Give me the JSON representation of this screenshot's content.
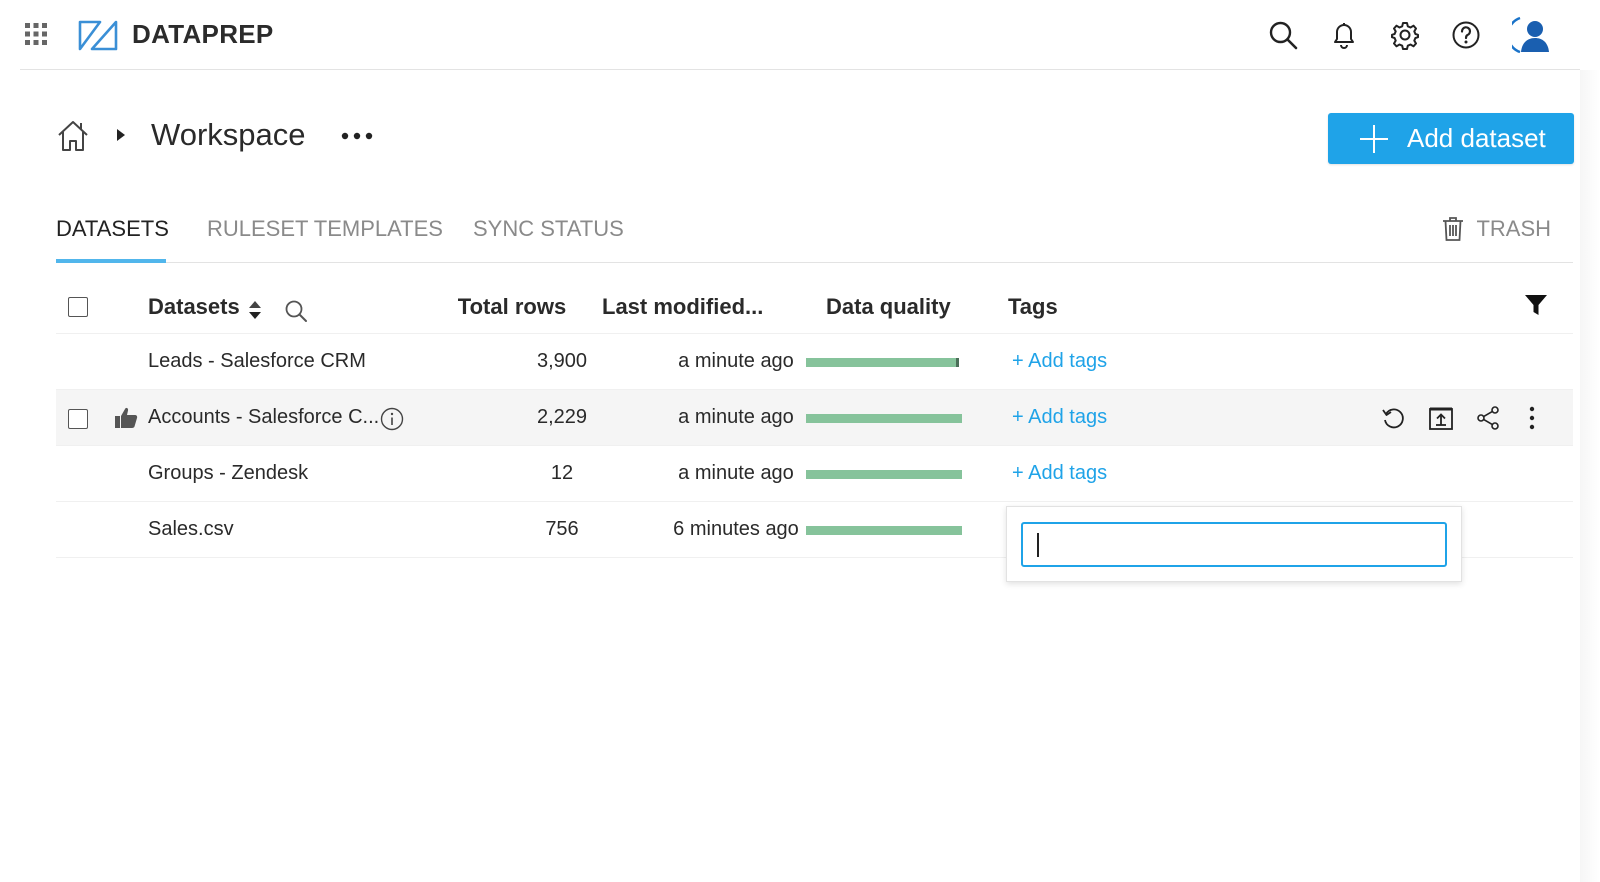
{
  "app": {
    "name": "DATAPREP"
  },
  "breadcrumb": {
    "title": "Workspace"
  },
  "actions": {
    "add_dataset_label": "Add dataset"
  },
  "tabs": [
    {
      "label": "DATASETS",
      "active": true
    },
    {
      "label": "RULESET TEMPLATES",
      "active": false
    },
    {
      "label": "SYNC STATUS",
      "active": false
    }
  ],
  "trash_label": "TRASH",
  "table": {
    "headers": {
      "datasets": "Datasets",
      "total_rows": "Total rows",
      "last_modified": "Last modified...",
      "data_quality": "Data quality",
      "tags": "Tags"
    },
    "rows": [
      {
        "name": "Leads - Salesforce CRM",
        "total_rows": "3,900",
        "last_modified": "a minute ago",
        "quality_fraction": 0.98,
        "tags_action": "+ Add tags"
      },
      {
        "name": "Accounts - Salesforce C...",
        "total_rows": "2,229",
        "last_modified": "a minute ago",
        "quality_fraction": 1.0,
        "tags_action": "+ Add tags"
      },
      {
        "name": "Groups - Zendesk",
        "total_rows": "12",
        "last_modified": "a minute ago",
        "quality_fraction": 1.0,
        "tags_action": "+ Add tags"
      },
      {
        "name": "Sales.csv",
        "total_rows": "756",
        "last_modified": "6 minutes ago",
        "quality_fraction": 1.0,
        "tags_action": ""
      }
    ]
  },
  "tag_input": {
    "value": ""
  },
  "colors": {
    "accent": "#1fa3e8",
    "quality_bar": "#86c39b",
    "tab_underline": "#51b6ec"
  },
  "icons": [
    "app-grid-icon",
    "dataprep-logo-icon",
    "search-icon",
    "bell-icon",
    "gear-icon",
    "help-icon",
    "user-avatar-icon",
    "home-icon",
    "more-icon",
    "plus-icon",
    "trash-icon",
    "sort-icon",
    "filter-icon",
    "thumbs-up-icon",
    "info-icon",
    "refresh-icon",
    "export-icon",
    "share-icon",
    "kebab-icon"
  ]
}
